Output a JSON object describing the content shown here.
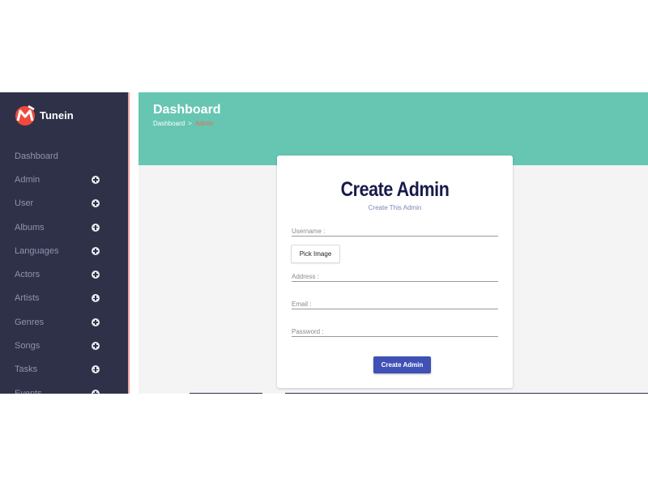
{
  "brand": {
    "name": "Tunein",
    "logo_icon": "tunein-logo-icon",
    "accent": "#ef4a3c"
  },
  "colors": {
    "sidebar": "#2f3148",
    "header": "#66c6b2",
    "primary_button": "#3f51b5",
    "breadcrumb_current": "#ef6b4f"
  },
  "sidebar": {
    "items": [
      {
        "label": "Dashboard",
        "expandable": false
      },
      {
        "label": "Admin",
        "expandable": true
      },
      {
        "label": "User",
        "expandable": true
      },
      {
        "label": "Albums",
        "expandable": true
      },
      {
        "label": "Languages",
        "expandable": true
      },
      {
        "label": "Actors",
        "expandable": true
      },
      {
        "label": "Artists",
        "expandable": true
      },
      {
        "label": "Genres",
        "expandable": true
      },
      {
        "label": "Songs",
        "expandable": true
      },
      {
        "label": "Tasks",
        "expandable": true
      },
      {
        "label": "Events",
        "expandable": true
      }
    ]
  },
  "header": {
    "title": "Dashboard",
    "breadcrumb": {
      "root": "Dashboard",
      "separator": ">",
      "current": "Admin"
    }
  },
  "form": {
    "title": "Create Admin",
    "subtitle": "Create This Admin",
    "username": {
      "placeholder": "Username :",
      "value": ""
    },
    "pick_image_label": "Pick Image",
    "address": {
      "placeholder": "Address :",
      "value": ""
    },
    "email": {
      "placeholder": "Email :",
      "value": ""
    },
    "password": {
      "placeholder": "Password :",
      "value": ""
    },
    "submit_label": "Create Admin"
  }
}
